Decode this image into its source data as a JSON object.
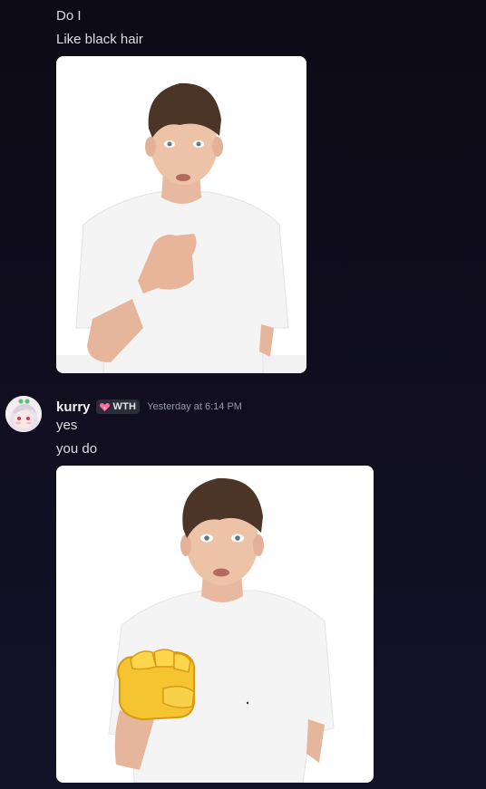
{
  "messages_top": {
    "line1": "Do I",
    "line2": "Like black hair"
  },
  "message_kurry": {
    "username": "kurry",
    "tag_label": "WTH",
    "timestamp": "Yesterday at 6:14 PM",
    "line1": "yes",
    "line2": "you do"
  },
  "icons": {
    "tag_icon": "fire-heart-icon",
    "avatar": "anime-avatar"
  }
}
